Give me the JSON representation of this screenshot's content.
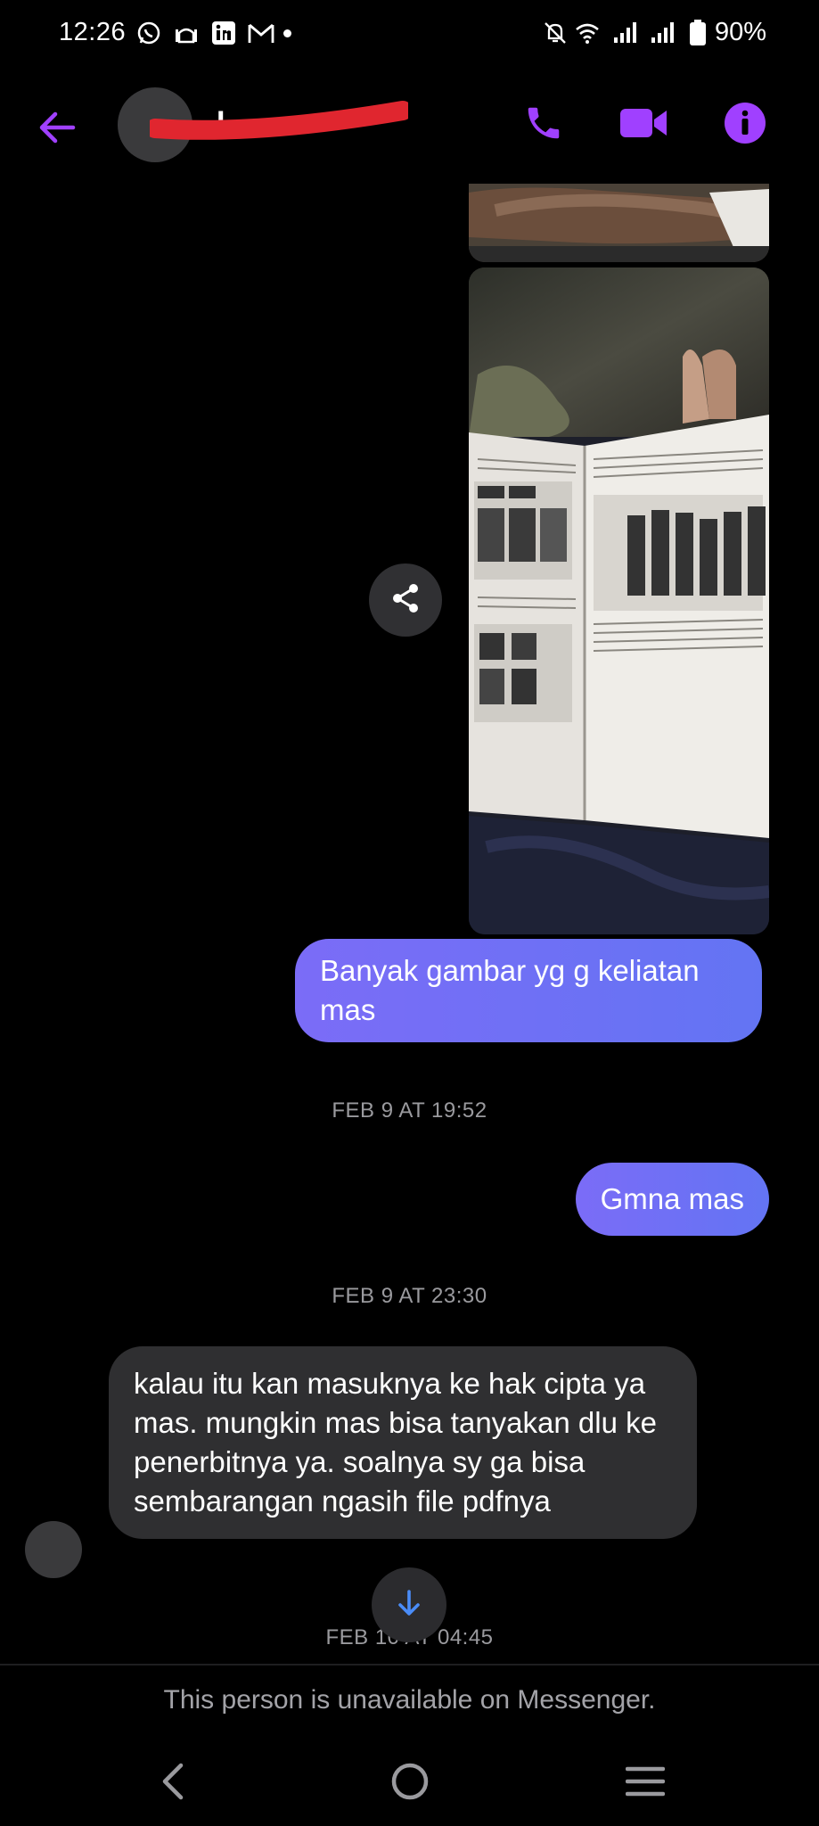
{
  "status_bar": {
    "time": "12:26",
    "battery": "90%",
    "icons": [
      "whatsapp-icon",
      "mosque-icon",
      "linkedin-icon",
      "gmail-icon",
      "silent-bell-icon",
      "wifi-icon",
      "signal-icon",
      "signal-icon",
      "battery-icon"
    ]
  },
  "header": {
    "contact_name": "I",
    "back_icon": "arrow-left-icon",
    "call_icon": "phone-icon",
    "video_icon": "video-camera-icon",
    "info_icon": "info-icon",
    "accent_color": "#a040ff"
  },
  "messages": [
    {
      "type": "image",
      "direction": "outgoing",
      "description_icon": "photo"
    },
    {
      "type": "image",
      "direction": "outgoing",
      "description_icon": "photo"
    },
    {
      "type": "text",
      "direction": "outgoing",
      "text": "Banyak gambar yg g keliatan mas"
    },
    {
      "type": "timestamp",
      "text": "FEB 9 AT 19:52"
    },
    {
      "type": "text",
      "direction": "outgoing",
      "text": "Gmna mas"
    },
    {
      "type": "timestamp",
      "text": "FEB 9 AT 23:30"
    },
    {
      "type": "text",
      "direction": "incoming",
      "text": "kalau itu kan masuknya ke hak cipta ya mas. mungkin mas bisa tanyakan dlu ke penerbitnya ya. soalnya sy ga bisa sembarangan ngasih file pdfnya"
    },
    {
      "type": "timestamp",
      "text": "FEB 10 AT 04:45"
    }
  ],
  "footer": {
    "unavailable_text": "This person is unavailable on Messenger."
  },
  "colors": {
    "outgoing_bubble_start": "#7b6cf7",
    "outgoing_bubble_end": "#6374f3",
    "incoming_bubble": "#2f2f31",
    "scroll_arrow": "#4a8cf7"
  }
}
